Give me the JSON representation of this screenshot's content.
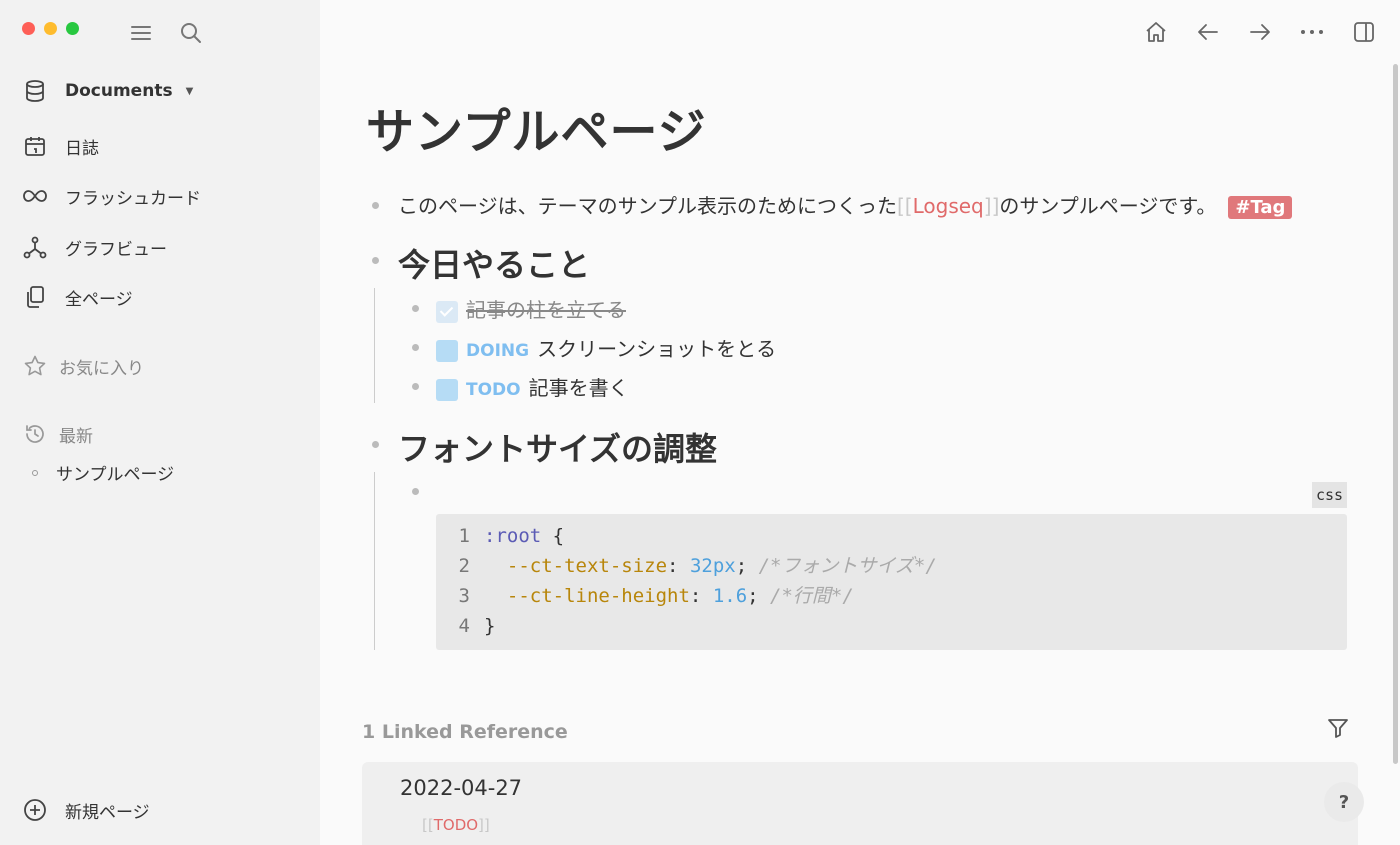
{
  "sidebar": {
    "documents_label": "Documents",
    "items": [
      {
        "label": "日誌",
        "icon": "calendar-icon"
      },
      {
        "label": "フラッシュカード",
        "icon": "infinity-icon"
      },
      {
        "label": "グラフビュー",
        "icon": "graph-icon"
      },
      {
        "label": "全ページ",
        "icon": "pages-icon"
      }
    ],
    "favorites_label": "お気に入り",
    "recent_label": "最新",
    "recent_items": [
      "サンプルページ"
    ],
    "new_page_label": "新規ページ"
  },
  "page": {
    "title": "サンプルページ",
    "intro_pre": "このページは、テーマのサンプル表示のためにつくった",
    "intro_link": "Logseq",
    "intro_post": "のサンプルページです。",
    "tag": "#Tag",
    "heading1": "今日やること",
    "tasks": [
      {
        "marker": "",
        "text": "記事の柱を立てる",
        "done": true
      },
      {
        "marker": "DOING",
        "text": "スクリーンショットをとる",
        "done": false
      },
      {
        "marker": "TODO",
        "text": "記事を書く",
        "done": false
      }
    ],
    "heading2": "フォントサイズの調整",
    "code_lang": "css",
    "code_lines": [
      {
        "n": "1",
        "sel": ":root",
        "rest": " {"
      },
      {
        "n": "2",
        "prop": "--ct-text-size",
        "val": "32px",
        "comment": "/*フォントサイズ*/"
      },
      {
        "n": "3",
        "prop": "--ct-line-height",
        "val": "1.6",
        "comment": "/*行間*/"
      },
      {
        "n": "4",
        "rest": "}"
      }
    ]
  },
  "references": {
    "title": "1 Linked Reference",
    "date": "2022-04-27",
    "todo_link": "TODO"
  },
  "help_label": "?",
  "colors": {
    "tag_bg": "#e0787b",
    "link": "#e06a6a",
    "marker": "#7fbef0",
    "checkbox": "#b6dcf5"
  }
}
